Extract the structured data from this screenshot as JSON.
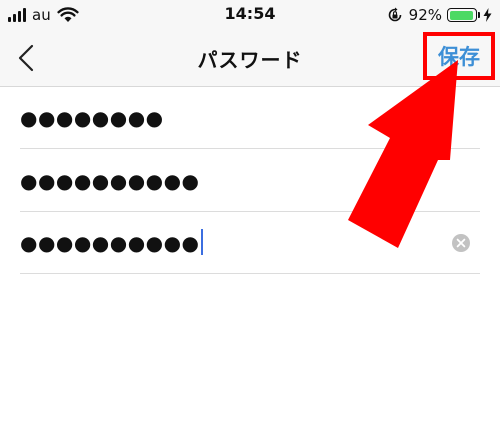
{
  "status_bar": {
    "carrier": "au",
    "time": "14:54",
    "battery_percent": "92%",
    "battery_level": 0.92
  },
  "nav": {
    "title": "パスワード",
    "save_label": "保存"
  },
  "fields": [
    {
      "masked_value": "●●●●●●●●"
    },
    {
      "masked_value": "●●●●●●●●●●"
    },
    {
      "masked_value": "●●●●●●●●●●"
    }
  ],
  "colors": {
    "accent": "#3d8fd6",
    "highlight": "#ff0000",
    "caret": "#3b6ee0",
    "battery": "#4cd964"
  },
  "icons": [
    "back-chevron-icon",
    "clear-icon",
    "wifi-icon",
    "orientation-lock-icon",
    "charging-bolt-icon"
  ]
}
